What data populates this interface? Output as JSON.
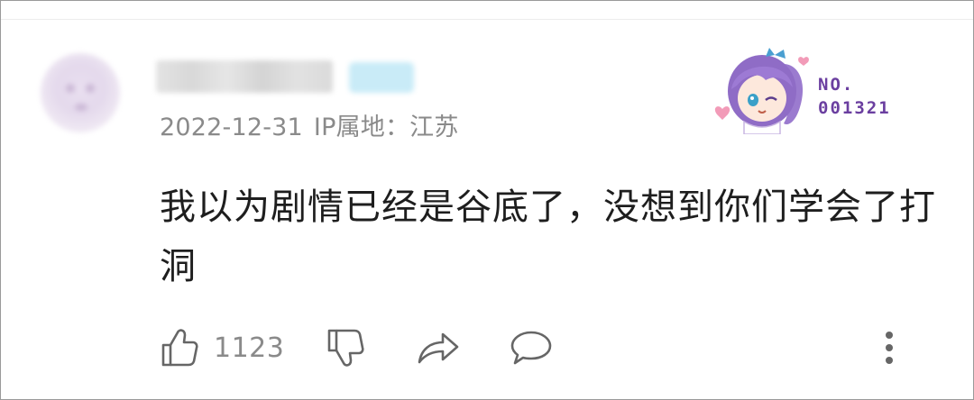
{
  "comment": {
    "date": "2022-12-31",
    "ip_location": "IP属地：江苏",
    "text": "我以为剧情已经是谷底了，没想到你们学会了打洞"
  },
  "badge": {
    "no_label": "NO.",
    "number": "001321"
  },
  "actions": {
    "like_count": "1123",
    "icons": [
      "thumbs-up-icon",
      "thumbs-down-icon",
      "share-icon",
      "reply-icon",
      "more-icon"
    ]
  },
  "colors": {
    "text_primary": "#1e1e1e",
    "text_secondary": "#8a8a8a",
    "badge_purple": "#6b3fa0"
  }
}
